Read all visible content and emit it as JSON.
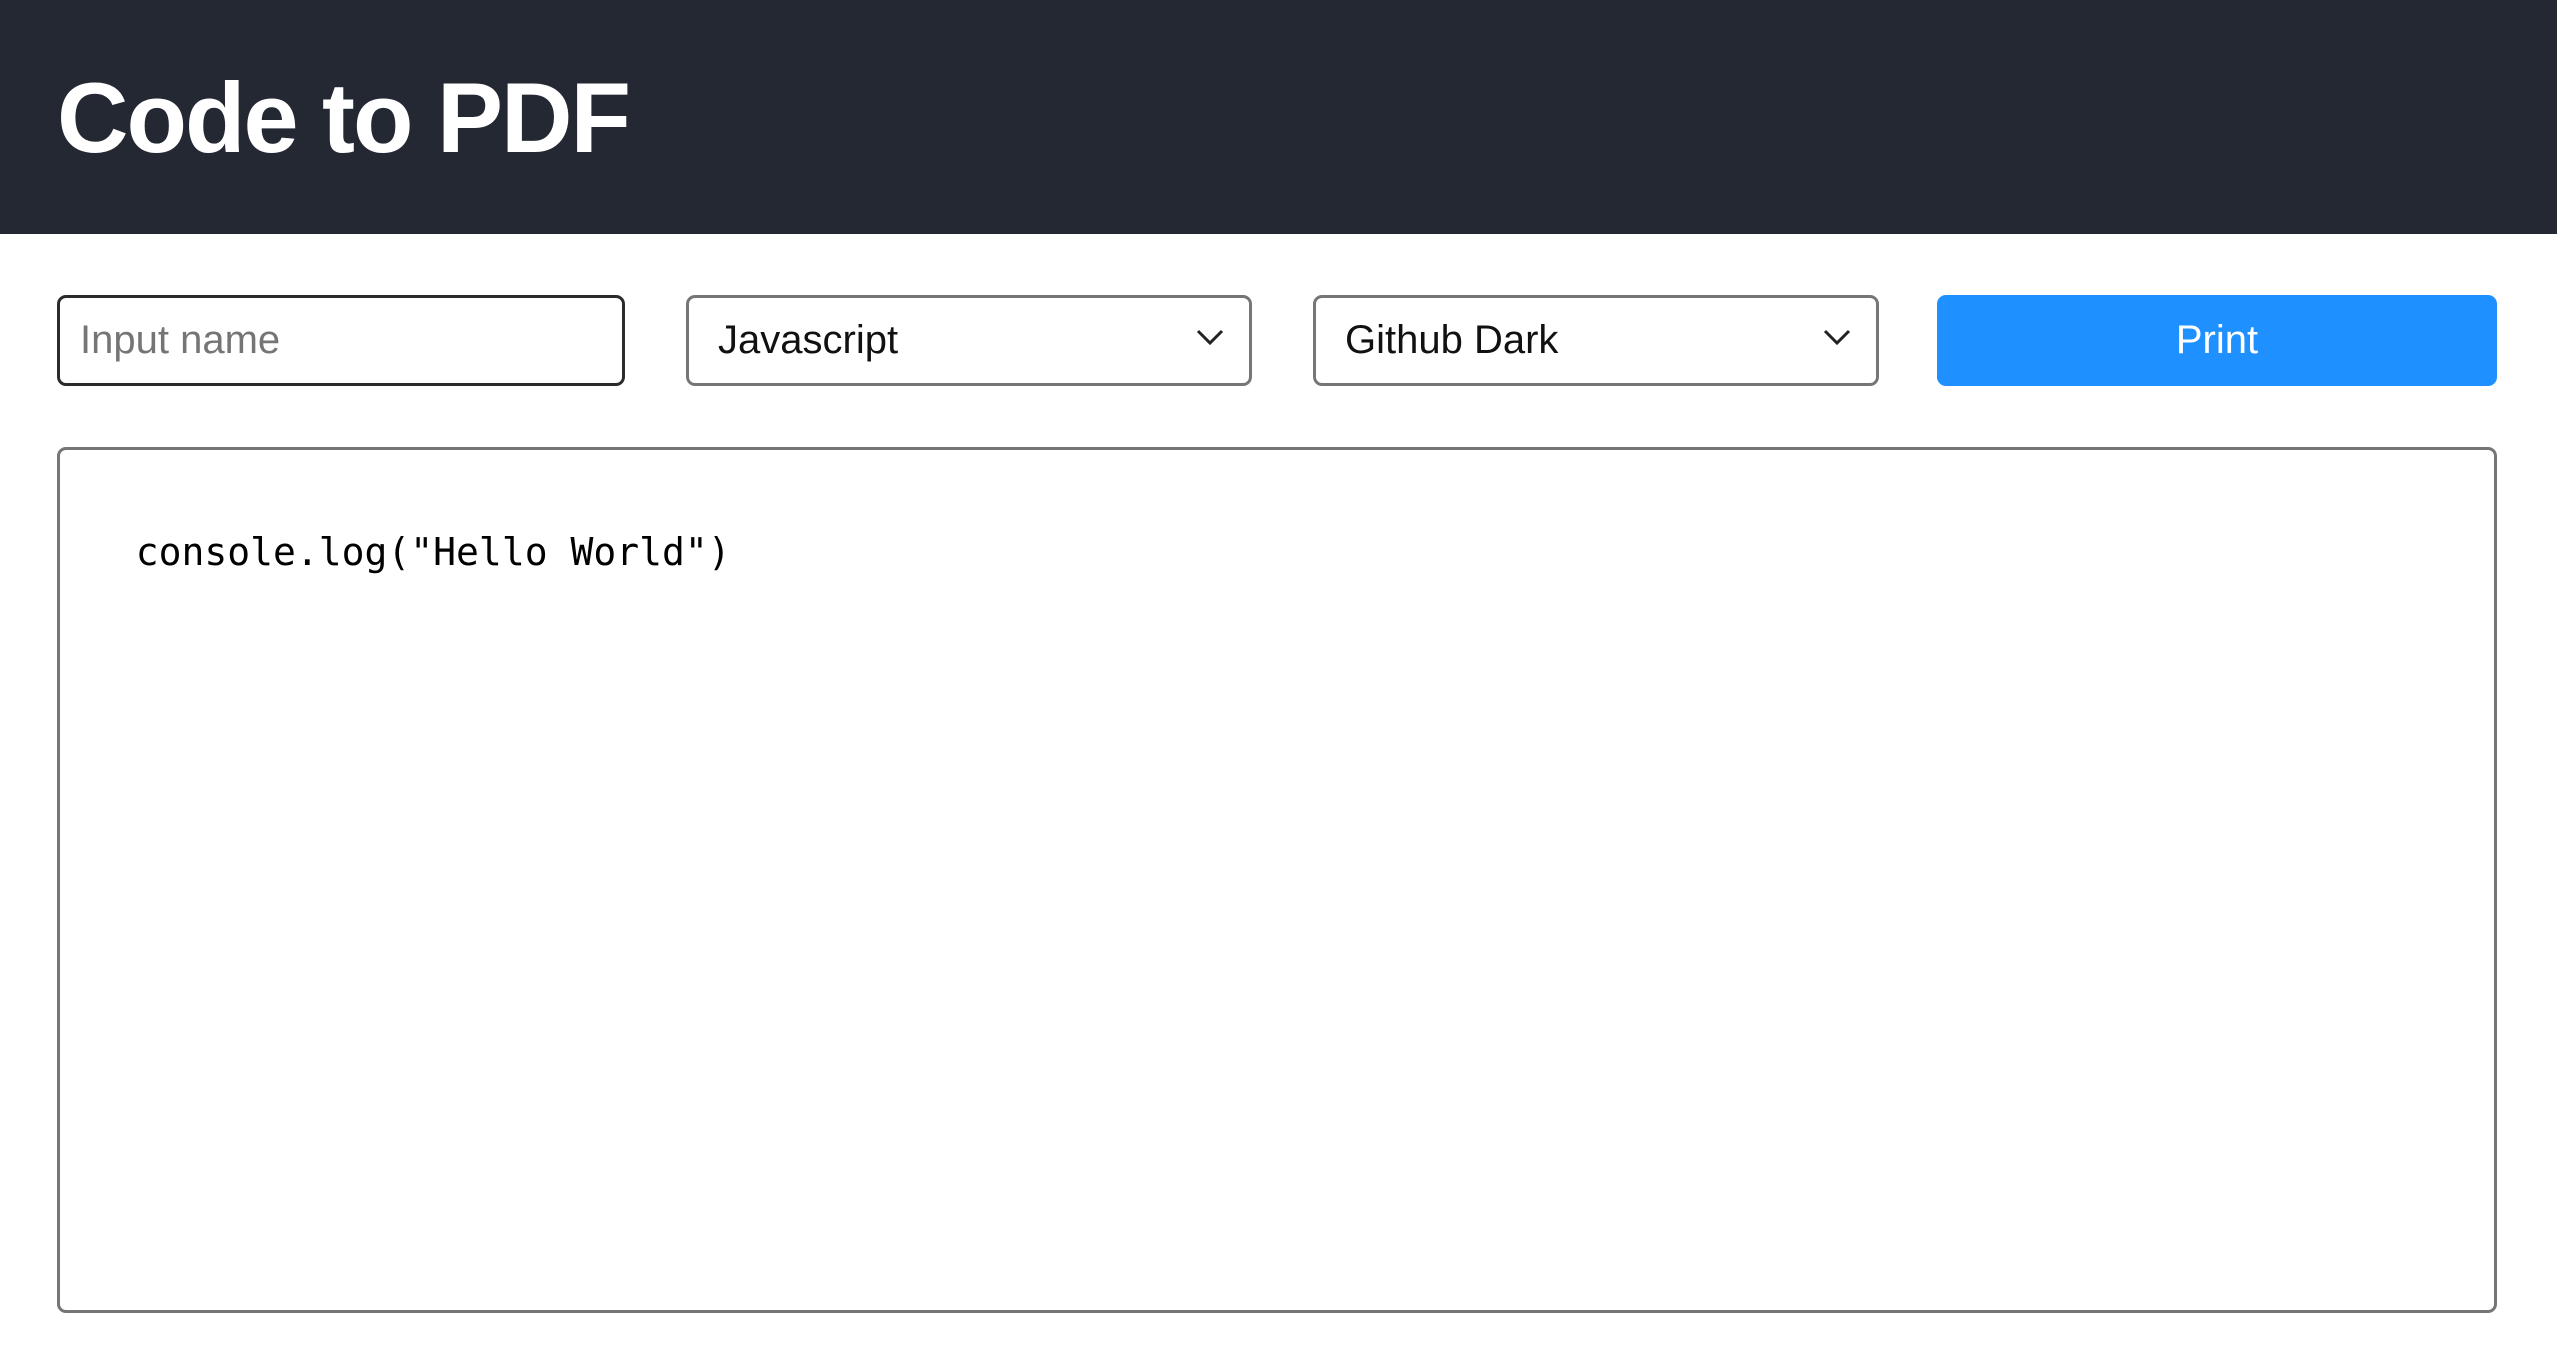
{
  "header": {
    "title": "Code to PDF"
  },
  "toolbar": {
    "name_input": {
      "value": "",
      "placeholder": "Input name"
    },
    "language_select": {
      "selected": "Javascript"
    },
    "theme_select": {
      "selected": "Github Dark"
    },
    "print_label": "Print"
  },
  "editor": {
    "code": "console.log(\"Hello World\")"
  },
  "colors": {
    "header_bg": "#232833",
    "accent": "#1e90ff",
    "text": "#000000"
  },
  "icons": {
    "select_arrow": "chevron-down-icon"
  }
}
